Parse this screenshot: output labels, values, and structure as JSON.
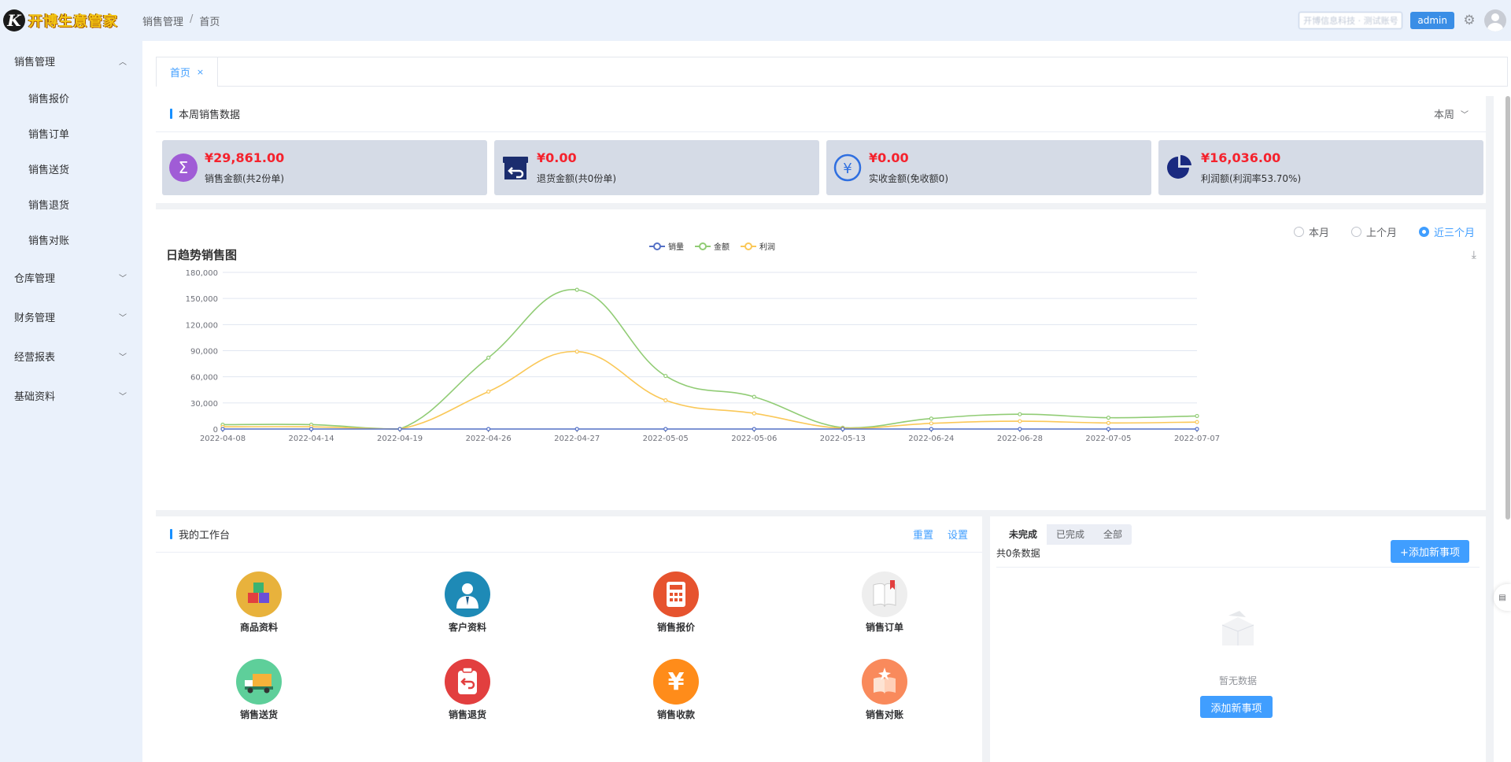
{
  "app": {
    "logo_text": "开博生意管家"
  },
  "breadcrumb": [
    "销售管理",
    "首页"
  ],
  "header": {
    "search_blurred": "开博信息科技 · 测试账号",
    "user_label": "admin"
  },
  "sidebar": {
    "groups": [
      {
        "label": "销售管理",
        "expanded": true,
        "items": [
          "销售报价",
          "销售订单",
          "销售送货",
          "销售退货",
          "销售对账"
        ]
      },
      {
        "label": "仓库管理",
        "expanded": false
      },
      {
        "label": "财务管理",
        "expanded": false
      },
      {
        "label": "经营报表",
        "expanded": false
      },
      {
        "label": "基础资料",
        "expanded": false
      }
    ]
  },
  "tabs": [
    {
      "label": "首页",
      "active": true
    }
  ],
  "weekly": {
    "title": "本周销售数据",
    "period": "本周",
    "stats": [
      {
        "amount": "¥29,861.00",
        "label": "销售金额(共2份单)",
        "icon": "sum-icon",
        "color": "#a05cd6"
      },
      {
        "amount": "¥0.00",
        "label": "退货金额(共0份单)",
        "icon": "return-box-icon",
        "color": "#1b2d6e"
      },
      {
        "amount": "¥0.00",
        "label": "实收金额(免收额0)",
        "icon": "yen-icon",
        "color": "#2f6fe0"
      },
      {
        "amount": "¥16,036.00",
        "label": "利润额(利润率53.70%)",
        "icon": "pie-icon",
        "color": "#1a2a80"
      }
    ]
  },
  "trend": {
    "title": "日趋势销售图",
    "ranges": [
      {
        "label": "本月",
        "selected": false
      },
      {
        "label": "上个月",
        "selected": false
      },
      {
        "label": "近三个月",
        "selected": true
      }
    ]
  },
  "chart_data": {
    "type": "line",
    "title": "日趋势销售图",
    "x": [
      "2022-04-08",
      "2022-04-14",
      "2022-04-19",
      "2022-04-26",
      "2022-04-27",
      "2022-05-05",
      "2022-05-06",
      "2022-05-13",
      "2022-06-24",
      "2022-06-28",
      "2022-07-05",
      "2022-07-07"
    ],
    "ylim": [
      0,
      180000
    ],
    "yticks": [
      "0",
      "30,000",
      "60,000",
      "90,000",
      "120,000",
      "150,000",
      "180,000"
    ],
    "legend_position": "top-center",
    "smooth": true,
    "grid": true,
    "series": [
      {
        "name": "销量",
        "color": "#5470c6",
        "values": [
          0,
          0,
          0,
          0,
          0,
          0,
          0,
          0,
          0,
          0,
          0,
          0
        ]
      },
      {
        "name": "金额",
        "color": "#91cc75",
        "values": [
          5000,
          5000,
          0,
          82000,
          160000,
          61000,
          37000,
          1500,
          12000,
          17000,
          13000,
          15000
        ]
      },
      {
        "name": "利润",
        "color": "#fac858",
        "values": [
          2500,
          2500,
          0,
          43000,
          89000,
          33000,
          18000,
          800,
          6500,
          9000,
          7000,
          8000
        ]
      }
    ]
  },
  "workbench": {
    "title": "我的工作台",
    "reset": "重置",
    "settings": "设置",
    "items": [
      {
        "label": "商品资料",
        "icon": "goods-icon",
        "color": "#e8b23c"
      },
      {
        "label": "客户资料",
        "icon": "customer-icon",
        "color": "#1e8ab6"
      },
      {
        "label": "销售报价",
        "icon": "calculator-icon",
        "color": "#e6532e"
      },
      {
        "label": "销售订单",
        "icon": "order-book-icon",
        "color": "#eeeeee"
      },
      {
        "label": "销售送货",
        "icon": "truck-icon",
        "color": "#5ecf9a"
      },
      {
        "label": "销售退货",
        "icon": "return-icon",
        "color": "#e23f3f"
      },
      {
        "label": "销售收款",
        "icon": "yen-coin-icon",
        "color": "#ff8c1a"
      },
      {
        "label": "销售对账",
        "icon": "book-icon",
        "color": "#f98a5c"
      }
    ]
  },
  "todo": {
    "tabs": [
      {
        "label": "未完成",
        "active": true
      },
      {
        "label": "已完成",
        "active": false
      },
      {
        "label": "全部",
        "active": false
      }
    ],
    "count": "共0条数据",
    "add_btn": "+添加新事项",
    "empty_text": "暂无数据",
    "empty_btn": "添加新事项"
  }
}
